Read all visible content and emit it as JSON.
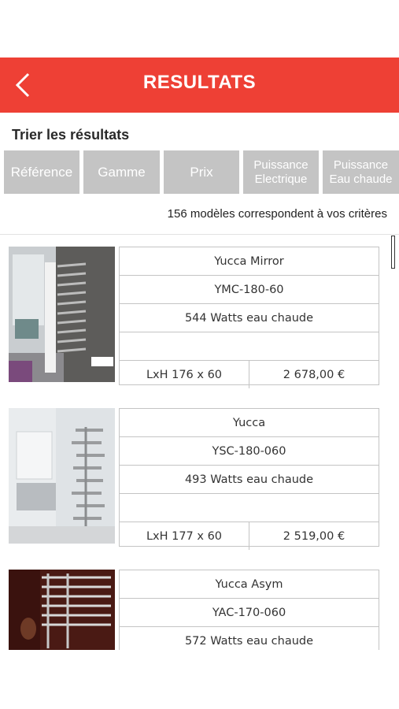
{
  "header": {
    "title": "RESULTATS",
    "back_icon": "chevron-left-icon",
    "color": "#ee4035"
  },
  "sort": {
    "label": "Trier les résultats",
    "buttons": [
      {
        "label": "Référence"
      },
      {
        "label": "Gamme"
      },
      {
        "label": "Prix"
      },
      {
        "label_line1": "Puissance",
        "label_line2": "Electrique"
      },
      {
        "label_line1": "Puissance",
        "label_line2": "Eau chaude"
      }
    ]
  },
  "results": {
    "count_text": "156 modèles correspondent à vos critères",
    "products": [
      {
        "name": "Yucca Mirror",
        "ref": "YMC-180-60",
        "power": "544 Watts eau chaude",
        "extra": "",
        "dims": "LxH 176 x 60",
        "price": "2 678,00 €"
      },
      {
        "name": "Yucca",
        "ref": "YSC-180-060",
        "power": "493 Watts eau chaude",
        "extra": "",
        "dims": "LxH 177 x 60",
        "price": "2 519,00 €"
      },
      {
        "name": "Yucca Asym",
        "ref": "YAC-170-060",
        "power": "572 Watts eau chaude"
      }
    ]
  }
}
